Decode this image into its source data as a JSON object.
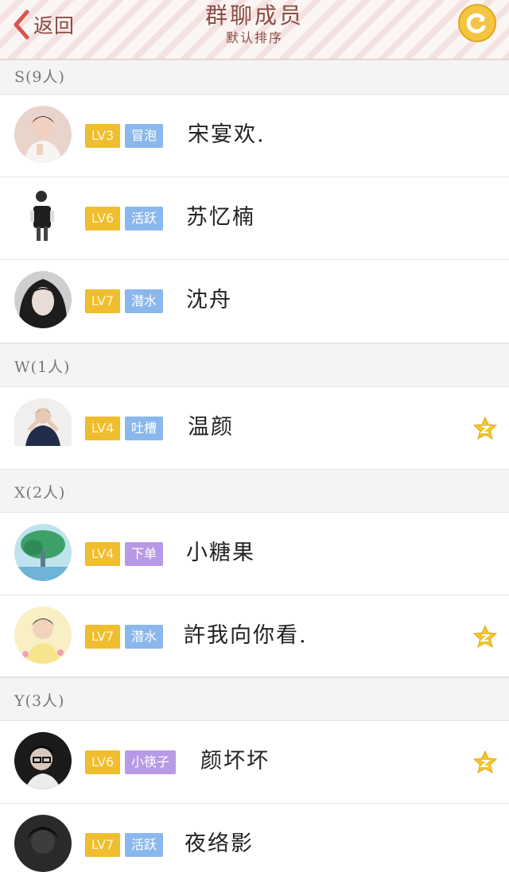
{
  "header": {
    "back_label": "返回",
    "title": "群聊成员",
    "subtitle": "默认排序"
  },
  "colors": {
    "level_badge": "#efbd2e",
    "role_blue": "#8bb8ec",
    "role_purple": "#b79ae6",
    "header_text": "#8a4b45",
    "star": "#f4c52b"
  },
  "sections": [
    {
      "label": "S(9人)",
      "members": [
        {
          "level": "LV3",
          "role": "冒泡",
          "role_color": "#8bb8ec",
          "name": "宋宴欢.",
          "star": false,
          "avatar": "avatar-boy-white-shirt"
        },
        {
          "level": "LV6",
          "role": "活跃",
          "role_color": "#8bb8ec",
          "name": "苏忆楠",
          "star": false,
          "avatar": "avatar-backpack-figure"
        },
        {
          "level": "LV7",
          "role": "潜水",
          "role_color": "#8bb8ec",
          "name": "沈舟",
          "star": false,
          "avatar": "avatar-girl-dark-hair"
        }
      ]
    },
    {
      "label": "W(1人)",
      "members": [
        {
          "level": "LV4",
          "role": "吐槽",
          "role_color": "#8bb8ec",
          "name": "温颜",
          "star": true,
          "avatar": "avatar-person-pose"
        }
      ]
    },
    {
      "label": "X(2人)",
      "members": [
        {
          "level": "LV4",
          "role": "下单",
          "role_color": "#b79ae6",
          "name": "小糖果",
          "star": false,
          "avatar": "avatar-tree-painting"
        },
        {
          "level": "LV7",
          "role": "潜水",
          "role_color": "#8bb8ec",
          "name": "許我向你看.",
          "star": true,
          "avatar": "avatar-boy-yellow"
        }
      ]
    },
    {
      "label": "Y(3人)",
      "members": [
        {
          "level": "LV6",
          "role": "小筷子",
          "role_color": "#b79ae6",
          "name": "颜坏坏",
          "star": true,
          "avatar": "avatar-boy-glasses"
        },
        {
          "level": "LV7",
          "role": "活跃",
          "role_color": "#8bb8ec",
          "name": "夜络影",
          "star": false,
          "avatar": "avatar-dark-portrait"
        }
      ]
    }
  ]
}
